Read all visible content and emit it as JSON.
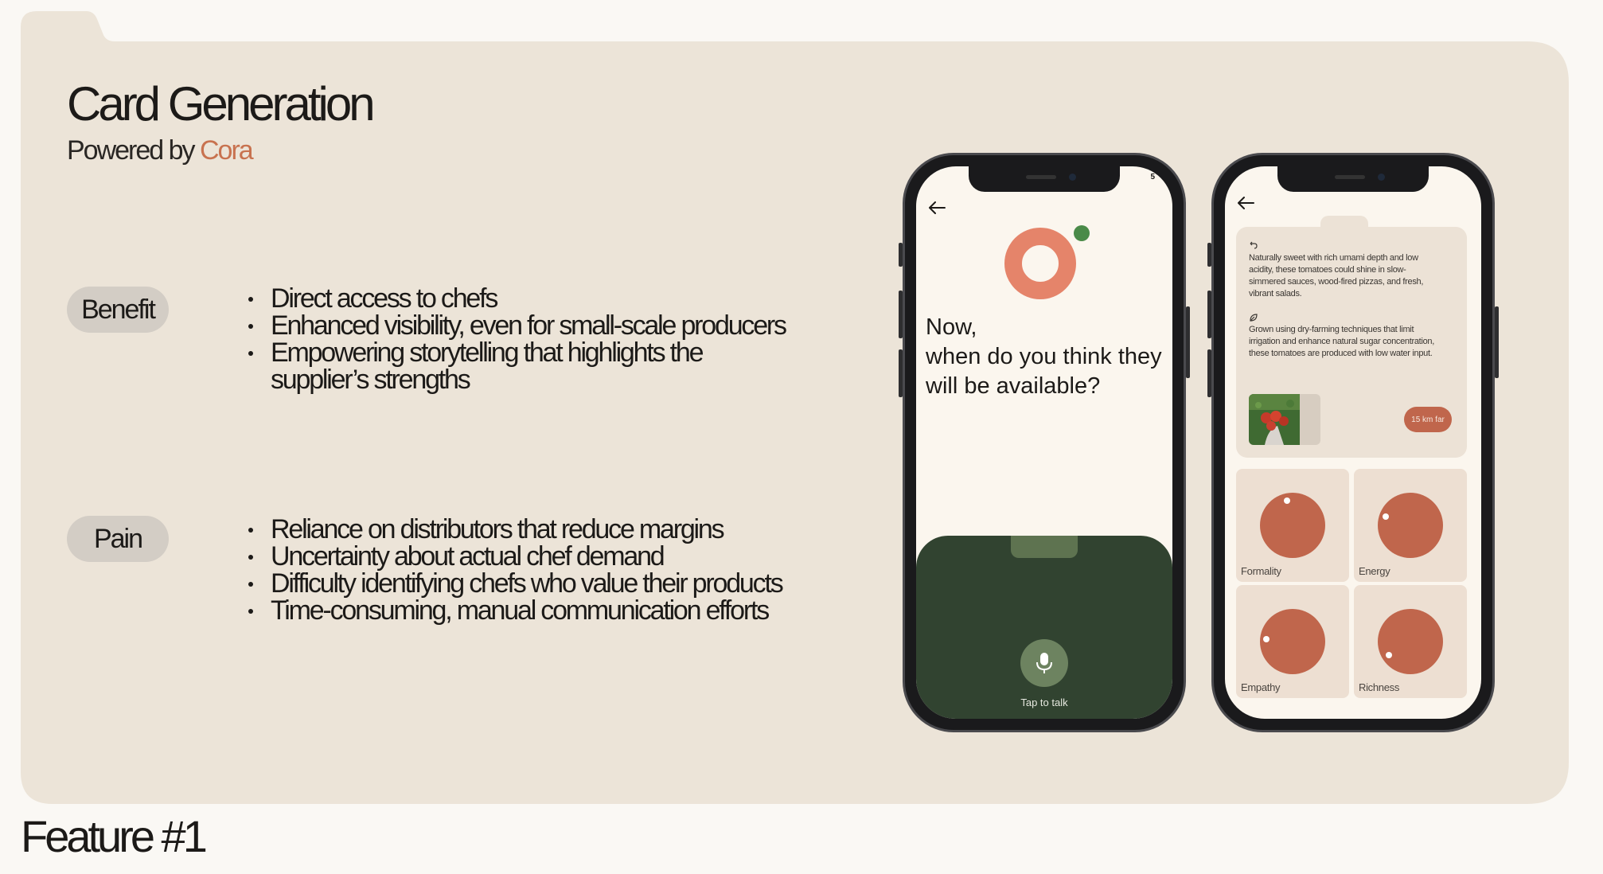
{
  "header": {
    "title": "Card Generation",
    "subtitle_prefix": "Powered by ",
    "subtitle_brand": "Cora"
  },
  "sections": {
    "benefit": {
      "label": "Benefit",
      "items": [
        "Direct access to chefs",
        "Enhanced visibility, even for small-scale producers",
        "Empowering storytelling that highlights the supplier’s strengths"
      ]
    },
    "pain": {
      "label": "Pain",
      "items": [
        "Reliance on distributors that reduce margins",
        "Uncertainty about actual chef demand",
        "Difficulty identifying chefs who value their products",
        "Time-consuming, manual communication efforts"
      ]
    }
  },
  "footer": {
    "feature_label": "Feature #1"
  },
  "phone1": {
    "status_number": "5",
    "question_line1": "Now,",
    "question_line2": "when do you think they",
    "question_line3": "will be available?",
    "tap_label": "Tap to talk"
  },
  "phone2": {
    "info1": "Naturally sweet with rich umami depth and low acidity, these tomatoes could shine in slow-simmered sauces, wood-fired pizzas, and fresh, vibrant salads.",
    "info2": "Grown using dry-farming techniques that limit irrigation and enhance natural sugar concentration, these tomatoes are produced with low water input.",
    "distance": "15 km far",
    "traits": [
      "Formality",
      "Energy",
      "Empathy",
      "Richness"
    ]
  },
  "colors": {
    "panel": "#ece4d8",
    "accent": "#c8724f",
    "cora_ring": "#e5846a",
    "cora_dot": "#4a8a48",
    "talk_panel": "#314330",
    "trait_disc": "#c0664c"
  },
  "icons": {
    "back": "arrow-left-icon",
    "mic": "microphone-icon",
    "info1": "sparkle-icon",
    "info2": "leaf-icon"
  }
}
